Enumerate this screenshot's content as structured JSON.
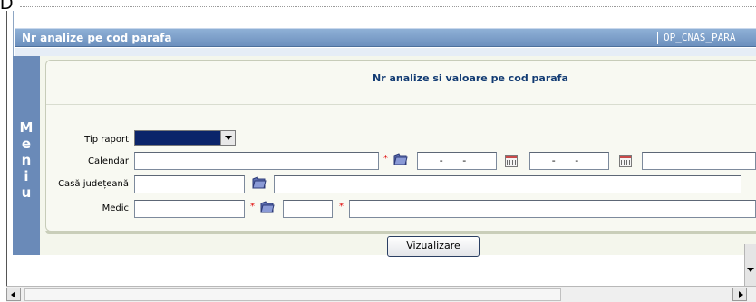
{
  "top_fragment": "D",
  "window": {
    "title": "Nr analize pe cod parafa",
    "code": "OP_CNAS_PARA"
  },
  "menu": {
    "letters": [
      "M",
      "e",
      "n",
      "i",
      "u"
    ]
  },
  "form": {
    "heading": "Nr analize si valoare pe cod parafa",
    "tip_raport": {
      "label": "Tip raport",
      "value": ""
    },
    "calendar": {
      "label": "Calendar",
      "value": "",
      "required_mark": "*",
      "date_from": "- -",
      "date_to": "- -",
      "extra_value": ""
    },
    "casa_judeteana": {
      "label": "Casă județeană",
      "code": "",
      "name": ""
    },
    "medic": {
      "label": "Medic",
      "value": "",
      "required_mark": "*",
      "code": "",
      "required_mark2": "*",
      "name": ""
    },
    "submit_label_prefix": "V",
    "submit_label_rest": "izualizare"
  },
  "icons": {
    "folder": "folder-icon",
    "calendar": "calendar-icon",
    "dropdown": "chevron-down-icon"
  },
  "colors": {
    "title_bar": "#7a9cc8",
    "menu_strip": "#6a8ab8",
    "heading_text": "#123b73",
    "required": "#e00000"
  }
}
